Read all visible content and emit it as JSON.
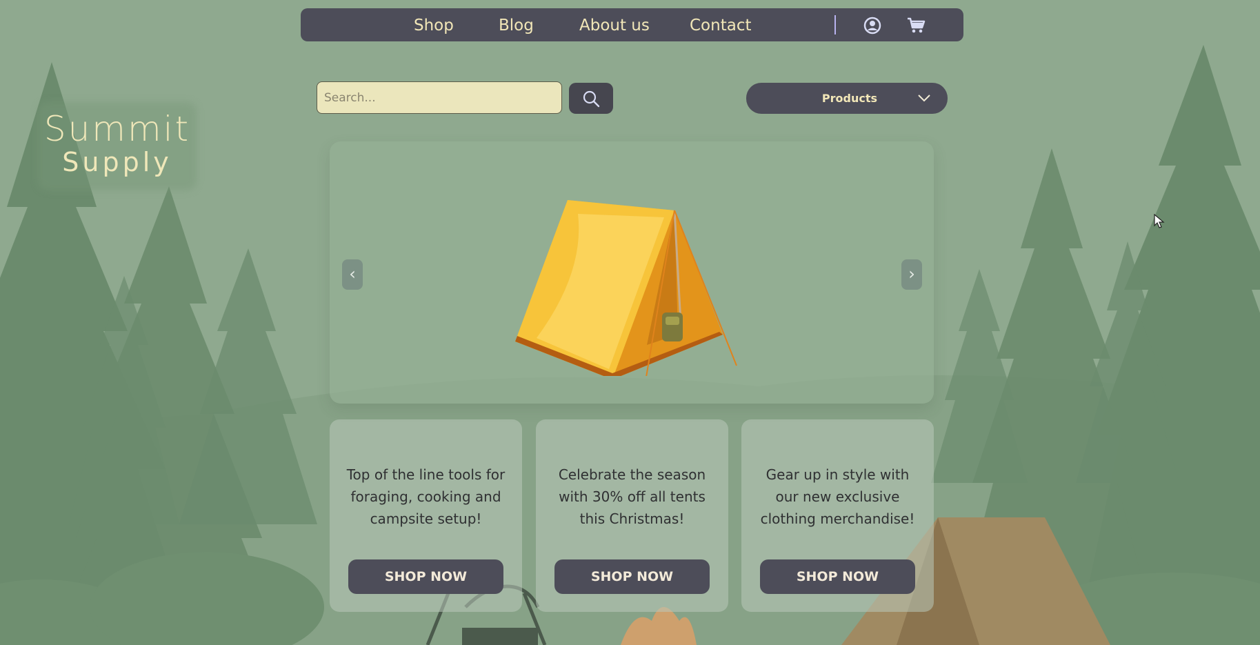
{
  "nav": {
    "links": [
      "Shop",
      "Blog",
      "About us",
      "Contact"
    ],
    "icons": [
      "user-circle-icon",
      "cart-icon"
    ]
  },
  "search": {
    "placeholder": "Search...",
    "value": ""
  },
  "products_dropdown": {
    "label": "Products"
  },
  "logo": {
    "line1": "Summit",
    "line2": "Supply"
  },
  "carousel": {
    "prev": "‹",
    "next": "›",
    "image": "tent-icon"
  },
  "cards": [
    {
      "text": "Top of the line tools for foraging, cooking and campsite setup!",
      "button": "SHOP NOW"
    },
    {
      "text": "Celebrate the season with 30% off all tents this Christmas!",
      "button": "SHOP NOW"
    },
    {
      "text": "Gear up in style with our new exclusive clothing merchandise!",
      "button": "SHOP NOW"
    }
  ],
  "colors": {
    "background": "#8fa98f",
    "nav": "#4d4d59",
    "accent_text": "#f2e7b8",
    "search_field": "#ebe6bc"
  }
}
